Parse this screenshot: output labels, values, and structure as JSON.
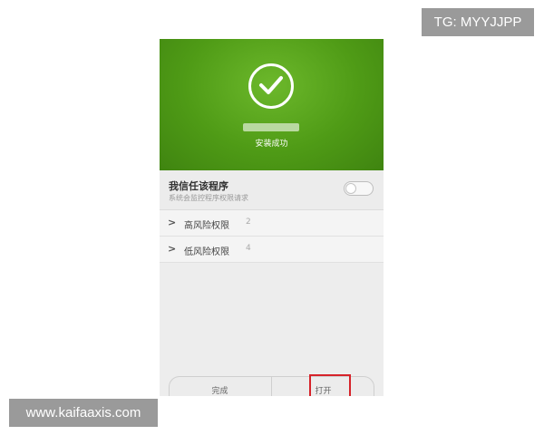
{
  "watermarks": {
    "top_right": "TG: MYYJJPP",
    "bottom_left": "www.kaifaaxis.com"
  },
  "install": {
    "status_text": "安装成功",
    "icon": "checkmark-icon",
    "hero_color": "#4f9b16"
  },
  "trust": {
    "title": "我信任该程序",
    "subtitle": "系统会监控程序权限请求",
    "toggle_on": false
  },
  "permissions": [
    {
      "label": "高风险权限",
      "count": "2"
    },
    {
      "label": "低风险权限",
      "count": "4"
    }
  ],
  "buttons": {
    "done_label": "完成",
    "open_label": "打开",
    "highlight_color": "#d6232a"
  }
}
